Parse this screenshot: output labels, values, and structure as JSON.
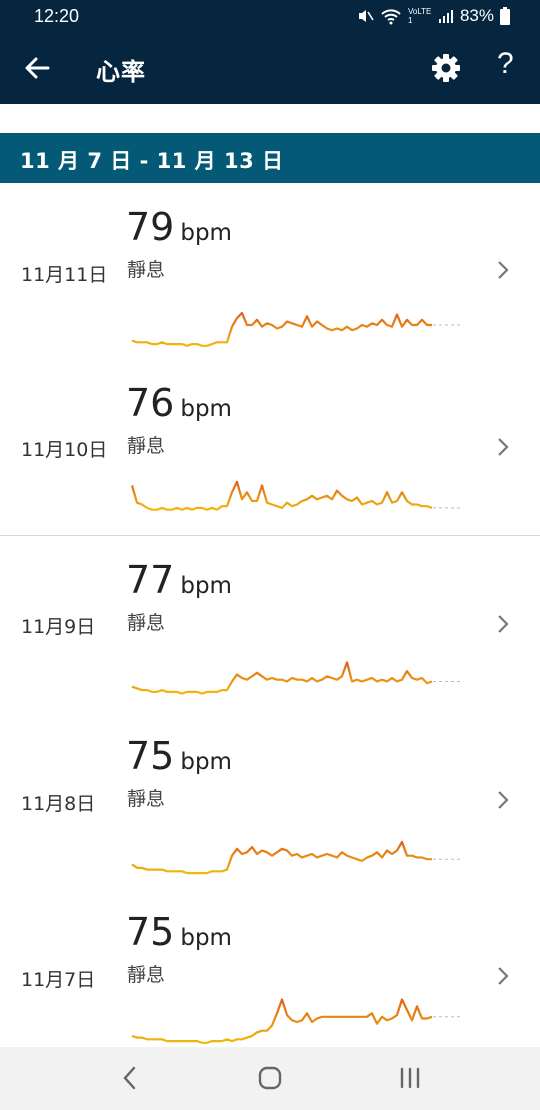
{
  "status": {
    "time": "12:20",
    "battery": "83%",
    "lte_label": "VoLTE1"
  },
  "header": {
    "title": "心率"
  },
  "week": {
    "range": "11 月 7 日 - 11 月 13 日"
  },
  "days": [
    {
      "date": "11月11日",
      "bpm": "79",
      "unit": "bpm",
      "label": "靜息",
      "trend": [
        6,
        5,
        5,
        5,
        4,
        4,
        5,
        4,
        4,
        4,
        4,
        3,
        4,
        4,
        3,
        3,
        4,
        5,
        5,
        5,
        14,
        19,
        22,
        15,
        15,
        18,
        14,
        16,
        15,
        13,
        14,
        17,
        16,
        15,
        14,
        20,
        14,
        17,
        15,
        13,
        12,
        13,
        12,
        14,
        12,
        13,
        15,
        14,
        16,
        15,
        18,
        15,
        14,
        21,
        14,
        18,
        15,
        15,
        18,
        15,
        15
      ]
    },
    {
      "date": "11月10日",
      "bpm": "76",
      "unit": "bpm",
      "label": "靜息",
      "trend": [
        24,
        14,
        13,
        11,
        10,
        10,
        11,
        10,
        10,
        11,
        10,
        11,
        10,
        11,
        11,
        10,
        11,
        10,
        12,
        12,
        20,
        26,
        16,
        20,
        15,
        15,
        24,
        14,
        13,
        12,
        11,
        14,
        12,
        13,
        15,
        16,
        18,
        16,
        17,
        18,
        16,
        21,
        18,
        16,
        15,
        17,
        13,
        14,
        15,
        13,
        14,
        20,
        14,
        15,
        20,
        15,
        13,
        13,
        12,
        12,
        11
      ]
    },
    {
      "date": "11月9日",
      "bpm": "77",
      "unit": "bpm",
      "label": "靜息",
      "trend": [
        10,
        9,
        8,
        8,
        7,
        7,
        8,
        7,
        7,
        7,
        6,
        7,
        7,
        7,
        6,
        7,
        7,
        7,
        8,
        8,
        13,
        17,
        15,
        14,
        16,
        18,
        16,
        14,
        15,
        14,
        14,
        13,
        15,
        14,
        14,
        13,
        15,
        13,
        14,
        16,
        15,
        14,
        16,
        24,
        13,
        14,
        13,
        14,
        15,
        13,
        14,
        13,
        15,
        13,
        14,
        19,
        15,
        14,
        15,
        12,
        13
      ]
    },
    {
      "date": "11月8日",
      "bpm": "75",
      "unit": "bpm",
      "label": "靜息",
      "trend": [
        9,
        7,
        7,
        6,
        6,
        6,
        6,
        5,
        5,
        5,
        5,
        4,
        4,
        4,
        4,
        4,
        5,
        5,
        5,
        6,
        14,
        18,
        15,
        16,
        19,
        15,
        17,
        16,
        14,
        16,
        18,
        17,
        14,
        15,
        13,
        14,
        15,
        13,
        14,
        15,
        14,
        13,
        16,
        14,
        13,
        12,
        11,
        13,
        14,
        16,
        13,
        17,
        15,
        17,
        22,
        14,
        14,
        13,
        13,
        12,
        12
      ]
    },
    {
      "date": "11月7日",
      "bpm": "75",
      "unit": "bpm",
      "label": "靜息",
      "trend": [
        7,
        6,
        6,
        5,
        5,
        5,
        5,
        4,
        4,
        4,
        4,
        4,
        4,
        4,
        3,
        3,
        4,
        4,
        4,
        5,
        4,
        5,
        5,
        6,
        7,
        9,
        10,
        10,
        13,
        20,
        28,
        19,
        16,
        15,
        16,
        20,
        15,
        17,
        18,
        18,
        18,
        18,
        18,
        18,
        18,
        18,
        18,
        18,
        20,
        14,
        18,
        16,
        17,
        19,
        28,
        22,
        16,
        24,
        17,
        17,
        18
      ]
    }
  ],
  "colors": {
    "app_bar": "#05263e",
    "week_header": "#045a76",
    "trend_low": "#f0b90d",
    "trend_high": "#e0621a"
  }
}
